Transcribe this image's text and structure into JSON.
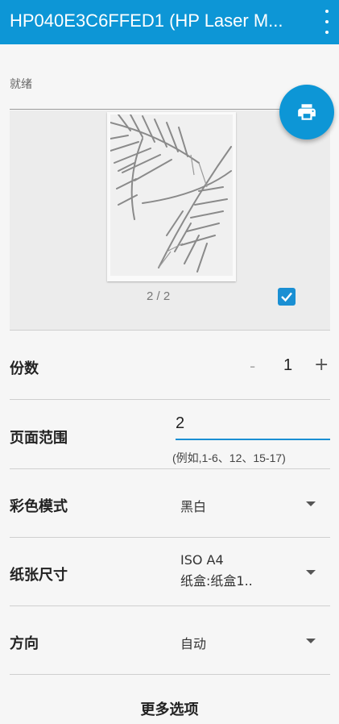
{
  "appbar": {
    "title": "HP040E3C6FFED1 (HP Laser M..."
  },
  "status": {
    "text": "就绪"
  },
  "preview": {
    "page_counter": "2 / 2",
    "page_selected": true
  },
  "copies": {
    "label": "份数",
    "minus": "-",
    "value": "1",
    "plus": "+"
  },
  "page_range": {
    "label": "页面范围",
    "value": "2",
    "hint": "(例如,1-6、12、15-17)"
  },
  "color_mode": {
    "label": "彩色模式",
    "value": "黑白"
  },
  "paper_size": {
    "label": "纸张尺寸",
    "value_line1": "ISO A4",
    "value_line2": "纸盒:纸盒1.."
  },
  "orientation": {
    "label": "方向",
    "value": "自动"
  },
  "more_options": {
    "label": "更多选项"
  },
  "colors": {
    "primary": "#0d96d6",
    "accent": "#1a8fd3"
  }
}
